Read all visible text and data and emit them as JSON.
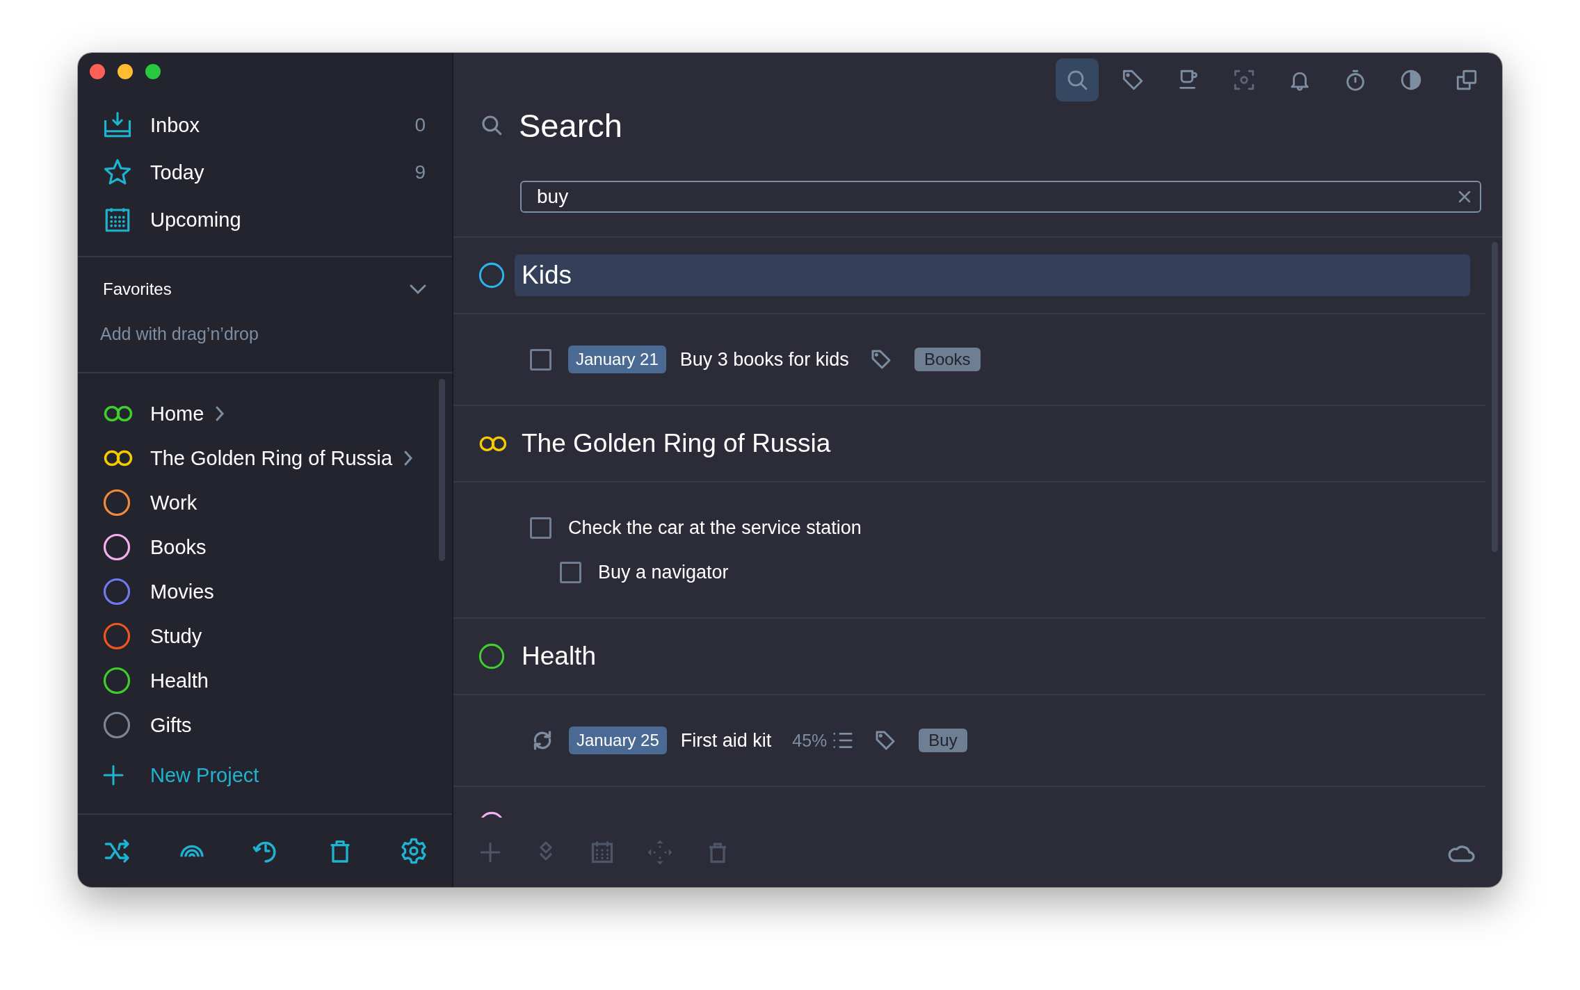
{
  "sidebar": {
    "nav": [
      {
        "kind": "inbox",
        "label": "Inbox",
        "count": "0"
      },
      {
        "kind": "today",
        "label": "Today",
        "count": "9"
      },
      {
        "kind": "upcoming",
        "label": "Upcoming"
      }
    ],
    "favorites": {
      "title": "Favorites",
      "hint": "Add with drag’n’drop"
    },
    "projects": [
      {
        "kind": "area",
        "label": "Home",
        "color": "#3ecf2b"
      },
      {
        "kind": "area",
        "label": "The Golden Ring of Russia",
        "color": "#f5cc00"
      },
      {
        "kind": "project",
        "label": "Work",
        "color": "#f08a3c"
      },
      {
        "kind": "project",
        "label": "Books",
        "color": "#f3b0ee"
      },
      {
        "kind": "project",
        "label": "Movies",
        "color": "#6f7af0"
      },
      {
        "kind": "project",
        "label": "Study",
        "color": "#f0561e"
      },
      {
        "kind": "project",
        "label": "Health",
        "color": "#3ecf2b"
      },
      {
        "kind": "project",
        "label": "Gifts",
        "color": "#7d8595"
      }
    ],
    "new_project": "New Project"
  },
  "toolbar": [
    {
      "kind": "search",
      "selected": true
    },
    {
      "kind": "tag",
      "selected": false
    },
    {
      "kind": "cup",
      "selected": false
    },
    {
      "kind": "focus",
      "selected": false
    },
    {
      "kind": "bell",
      "selected": false
    },
    {
      "kind": "timer",
      "selected": false
    },
    {
      "kind": "contrast",
      "selected": false
    },
    {
      "kind": "copy",
      "selected": false
    }
  ],
  "search": {
    "title": "Search",
    "value": "buy"
  },
  "groups": [
    {
      "kind": "project",
      "title": "Kids",
      "color": "#2bb5ee",
      "selected": true,
      "tasks": [
        {
          "kind": "checkbox",
          "checked": false,
          "date": "January 21",
          "title": "Buy 3 books for kids",
          "tag": "Books"
        }
      ]
    },
    {
      "kind": "area",
      "title": "The Golden Ring of Russia",
      "color": "#f5cc00",
      "selected": false,
      "tasks": [
        {
          "kind": "checkbox",
          "checked": false,
          "title": "Check the car at the service station",
          "children": [
            {
              "kind": "checkbox",
              "checked": false,
              "title": "Buy a navigator"
            }
          ]
        }
      ]
    },
    {
      "kind": "project",
      "title": "Health",
      "color": "#3ecf2b",
      "selected": false,
      "tasks": [
        {
          "kind": "repeat",
          "date": "January 25",
          "title": "First aid kit",
          "progress": "45%",
          "tag": "Buy"
        }
      ]
    },
    {
      "kind": "project",
      "color": "#f3b0ee"
    }
  ]
}
